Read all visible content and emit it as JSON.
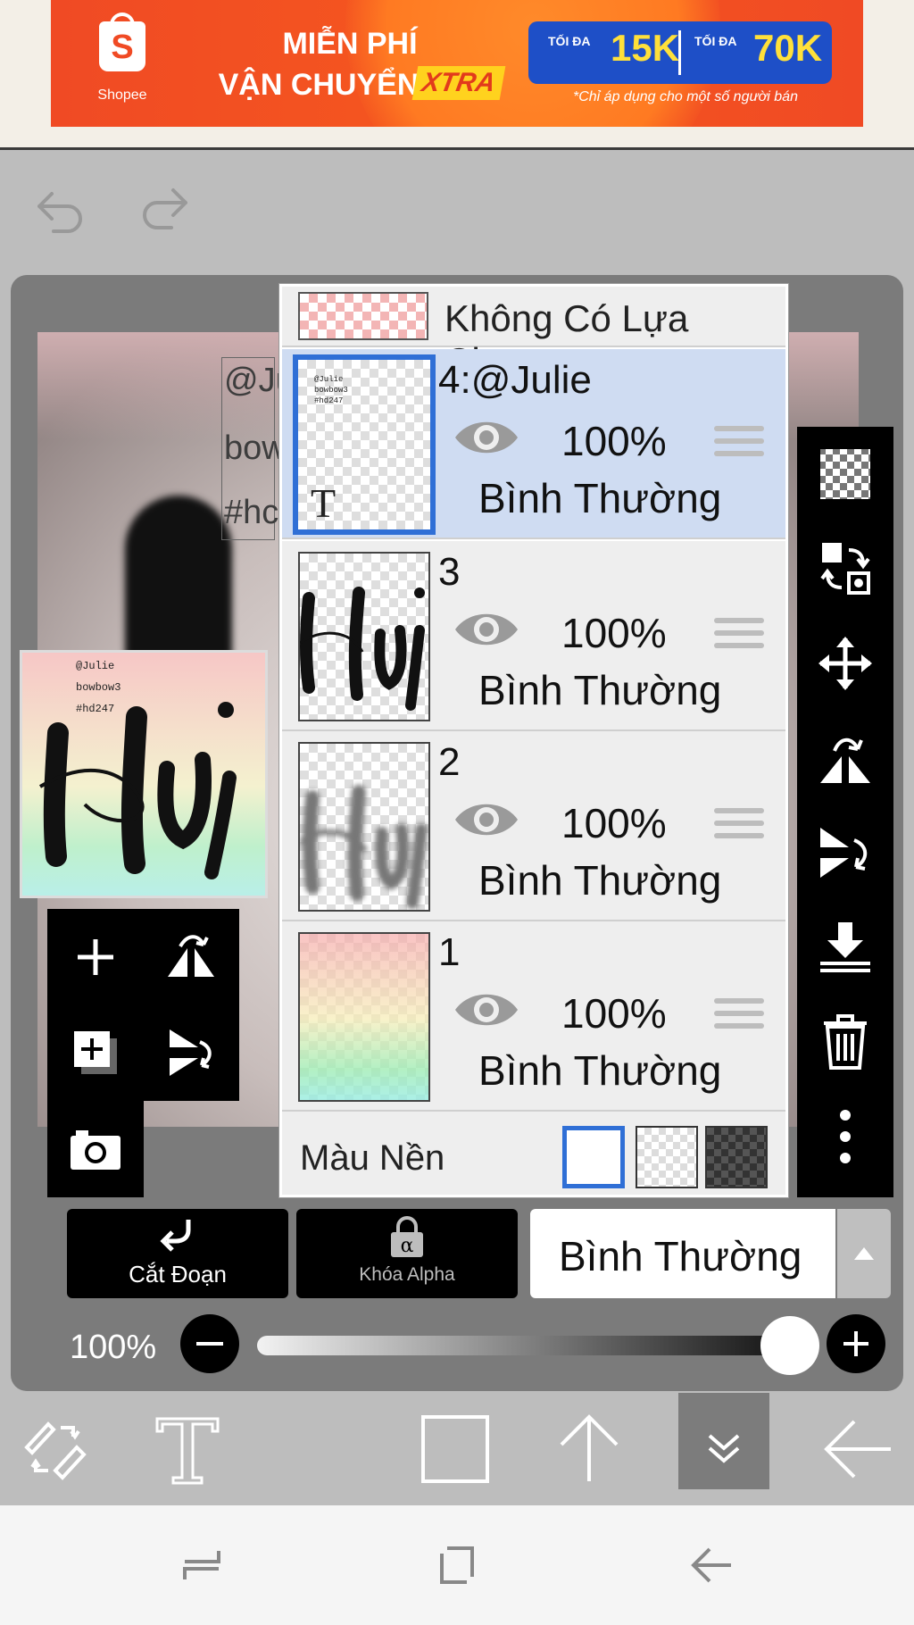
{
  "ad": {
    "brand": "Shopee",
    "line1": "MIỄN PHÍ",
    "line2": "VẬN CHUYỂN",
    "badge": "XTRA",
    "voucher1_small": "TỐI ĐA",
    "voucher1_big": "15K",
    "voucher2_small": "TỐI ĐA",
    "voucher2_big": "70K",
    "note": "*Chỉ áp dụng cho một số người bán",
    "colors": {
      "bg": "#f04a24",
      "voucher": "#1e4fc7",
      "accent": "#ffe03a"
    }
  },
  "toolbar": {
    "undo_icon": "undo-icon",
    "redo_icon": "redo-icon"
  },
  "canvas": {
    "text_lines": [
      "@Ju",
      "bow",
      "#hc"
    ]
  },
  "thumbnail": {
    "text_lines": [
      "@Julie",
      "bowbow3",
      "#hd247"
    ]
  },
  "layers_panel": {
    "no_selection_label": "Không Có Lựa Chọn",
    "layers": [
      {
        "name": "4:@Julie",
        "opacity": "100%",
        "blend": "Bình Thường",
        "selected": true
      },
      {
        "name": "3",
        "opacity": "100%",
        "blend": "Bình Thường",
        "selected": false
      },
      {
        "name": "2",
        "opacity": "100%",
        "blend": "Bình Thường",
        "selected": false
      },
      {
        "name": "1",
        "opacity": "100%",
        "blend": "Bình Thường",
        "selected": false
      }
    ],
    "background_label": "Màu Nền"
  },
  "controls": {
    "cut_label": "Cắt Đoạn",
    "alpha_label": "Khóa Alpha",
    "blend_mode": "Bình Thường",
    "opacity_label": "100%",
    "opacity_value": 1.0
  },
  "colors": {
    "selection": "#2f6fd6",
    "selected_row": "#cfdcf2",
    "panel_bg": "#eeeeee"
  }
}
